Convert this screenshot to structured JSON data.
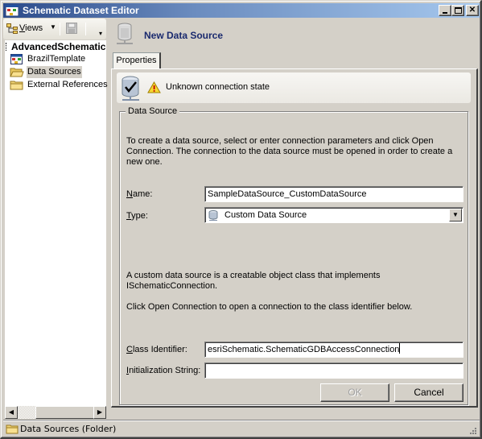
{
  "window": {
    "title": "Schematic Dataset Editor",
    "controls": {
      "minimize": "_",
      "maximize": "□",
      "close": "✕"
    }
  },
  "toolbar": {
    "views_label": "Views",
    "views_accesskey": "V",
    "icons": [
      "views-icon",
      "dropdown-arrow-icon",
      "save-icon",
      "toolbar-overflow-icon"
    ]
  },
  "tree": {
    "root": "AdvancedSchematic",
    "items": [
      {
        "label": "BrazilTemplate",
        "icon": "template-icon",
        "selected": false
      },
      {
        "label": "Data Sources",
        "icon": "folder-open-icon",
        "selected": true
      },
      {
        "label": "External References",
        "icon": "folder-icon",
        "selected": false
      }
    ]
  },
  "header": {
    "title": "New Data Source",
    "icon": "data-source-icon"
  },
  "tabs": [
    {
      "label": "Properties",
      "active": true
    }
  ],
  "status": {
    "text": "Unknown connection state",
    "icon": "warning-icon"
  },
  "data_source_group": {
    "legend": "Data Source",
    "intro": "To create a data source, select or enter connection parameters and click Open Connection.  The connection to the data source must be opened in order to create a new one.",
    "name_label": "Name:",
    "name_accesskey": "N",
    "name_value": "SampleDataSource_CustomDataSource",
    "type_label": "Type:",
    "type_accesskey": "T",
    "type_value": "Custom Data Source",
    "custom_desc_1": "A custom data source is a creatable object class that implements ISchematicConnection.",
    "custom_desc_2": "Click Open Connection to open a connection to the class identifier below.",
    "class_id_label": "Class Identifier:",
    "class_id_accesskey": "C",
    "class_id_value": "esriSchematic.SchematicGDBAccessConnection",
    "init_string_label": "Initialization String:",
    "init_string_accesskey": "I",
    "init_string_value": ""
  },
  "buttons": {
    "ok": "OK",
    "ok_enabled": false,
    "cancel": "Cancel"
  },
  "statusbar": {
    "text": "Data Sources (Folder)"
  }
}
